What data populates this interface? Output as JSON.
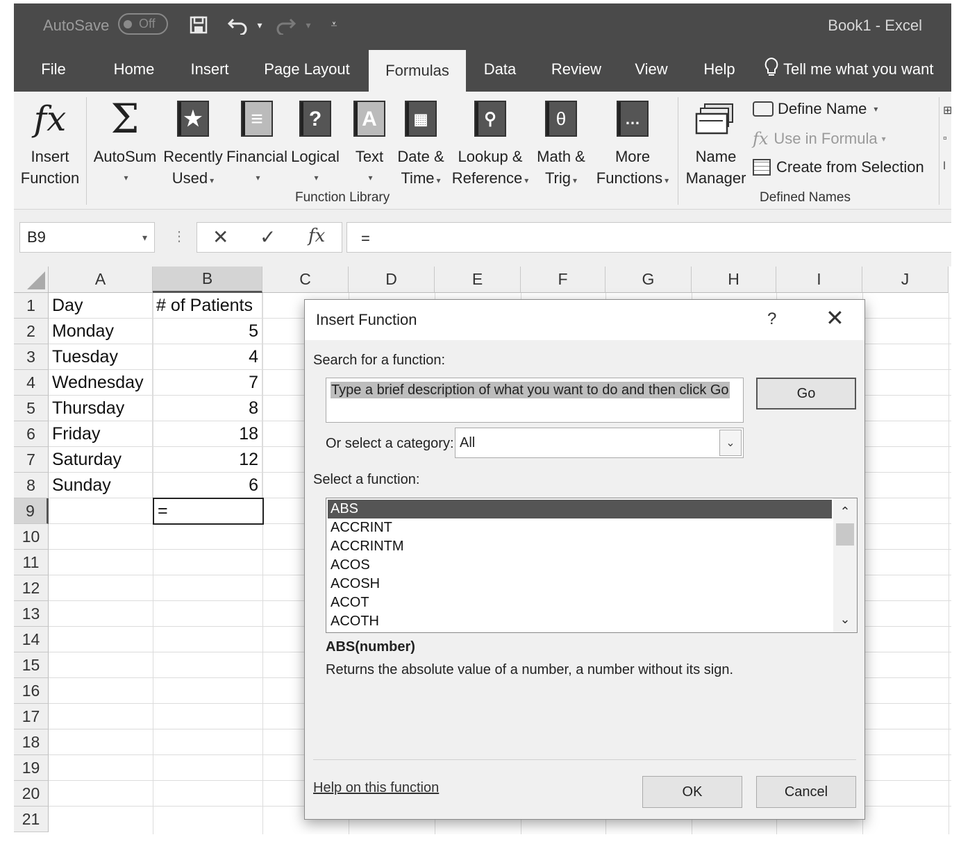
{
  "titlebar": {
    "autosave_label": "AutoSave",
    "autosave_state": "Off",
    "document_title": "Book1  -  Excel"
  },
  "tabs": [
    "File",
    "Home",
    "Insert",
    "Page Layout",
    "Formulas",
    "Data",
    "Review",
    "View",
    "Help"
  ],
  "active_tab": "Formulas",
  "tell_me": "Tell me what you want",
  "ribbon": {
    "function_library": {
      "insert_function": [
        "Insert",
        "Function"
      ],
      "autosum": "AutoSum",
      "recently_used": [
        "Recently",
        "Used"
      ],
      "financial": "Financial",
      "logical": "Logical",
      "text": "Text",
      "date_time": [
        "Date &",
        "Time"
      ],
      "lookup_reference": [
        "Lookup &",
        "Reference"
      ],
      "math_trig": [
        "Math &",
        "Trig"
      ],
      "more_functions": [
        "More",
        "Functions"
      ],
      "group_label": "Function Library"
    },
    "defined_names": {
      "name_manager": [
        "Name",
        "Manager"
      ],
      "define_name": "Define Name",
      "use_in_formula": "Use in Formula",
      "create_from_selection": "Create from Selection",
      "group_label": "Defined Names"
    }
  },
  "formula_bar": {
    "name_box": "B9",
    "formula": "="
  },
  "sheet": {
    "columns": [
      "A",
      "B",
      "C",
      "D",
      "E",
      "F",
      "G",
      "H",
      "I",
      "J"
    ],
    "rows": [
      "1",
      "2",
      "3",
      "4",
      "5",
      "6",
      "7",
      "8",
      "9",
      "10",
      "11",
      "12",
      "13",
      "14",
      "15",
      "16",
      "17",
      "18",
      "19",
      "20",
      "21"
    ],
    "cells": [
      {
        "day": "Day",
        "value": "# of Patients"
      },
      {
        "day": "Monday",
        "value": "5"
      },
      {
        "day": "Tuesday",
        "value": "4"
      },
      {
        "day": "Wednesday",
        "value": "7"
      },
      {
        "day": "Thursday",
        "value": "8"
      },
      {
        "day": "Friday",
        "value": "18"
      },
      {
        "day": "Saturday",
        "value": "12"
      },
      {
        "day": "Sunday",
        "value": "6"
      }
    ],
    "active_cell_value": "="
  },
  "dialog": {
    "title": "Insert Function",
    "help": "?",
    "search_label": "Search for a function:",
    "search_value": "Type a brief description of what you want to do and then click Go",
    "go": "Go",
    "category_label": "Or select a category:",
    "category_value": "All",
    "select_label": "Select a function:",
    "functions": [
      "ABS",
      "ACCRINT",
      "ACCRINTM",
      "ACOS",
      "ACOSH",
      "ACOT",
      "ACOTH"
    ],
    "selected_function": "ABS",
    "signature": "ABS(number)",
    "description": "Returns the absolute value of a number, a number without its sign.",
    "help_link": "Help on this function",
    "ok": "OK",
    "cancel": "Cancel"
  }
}
